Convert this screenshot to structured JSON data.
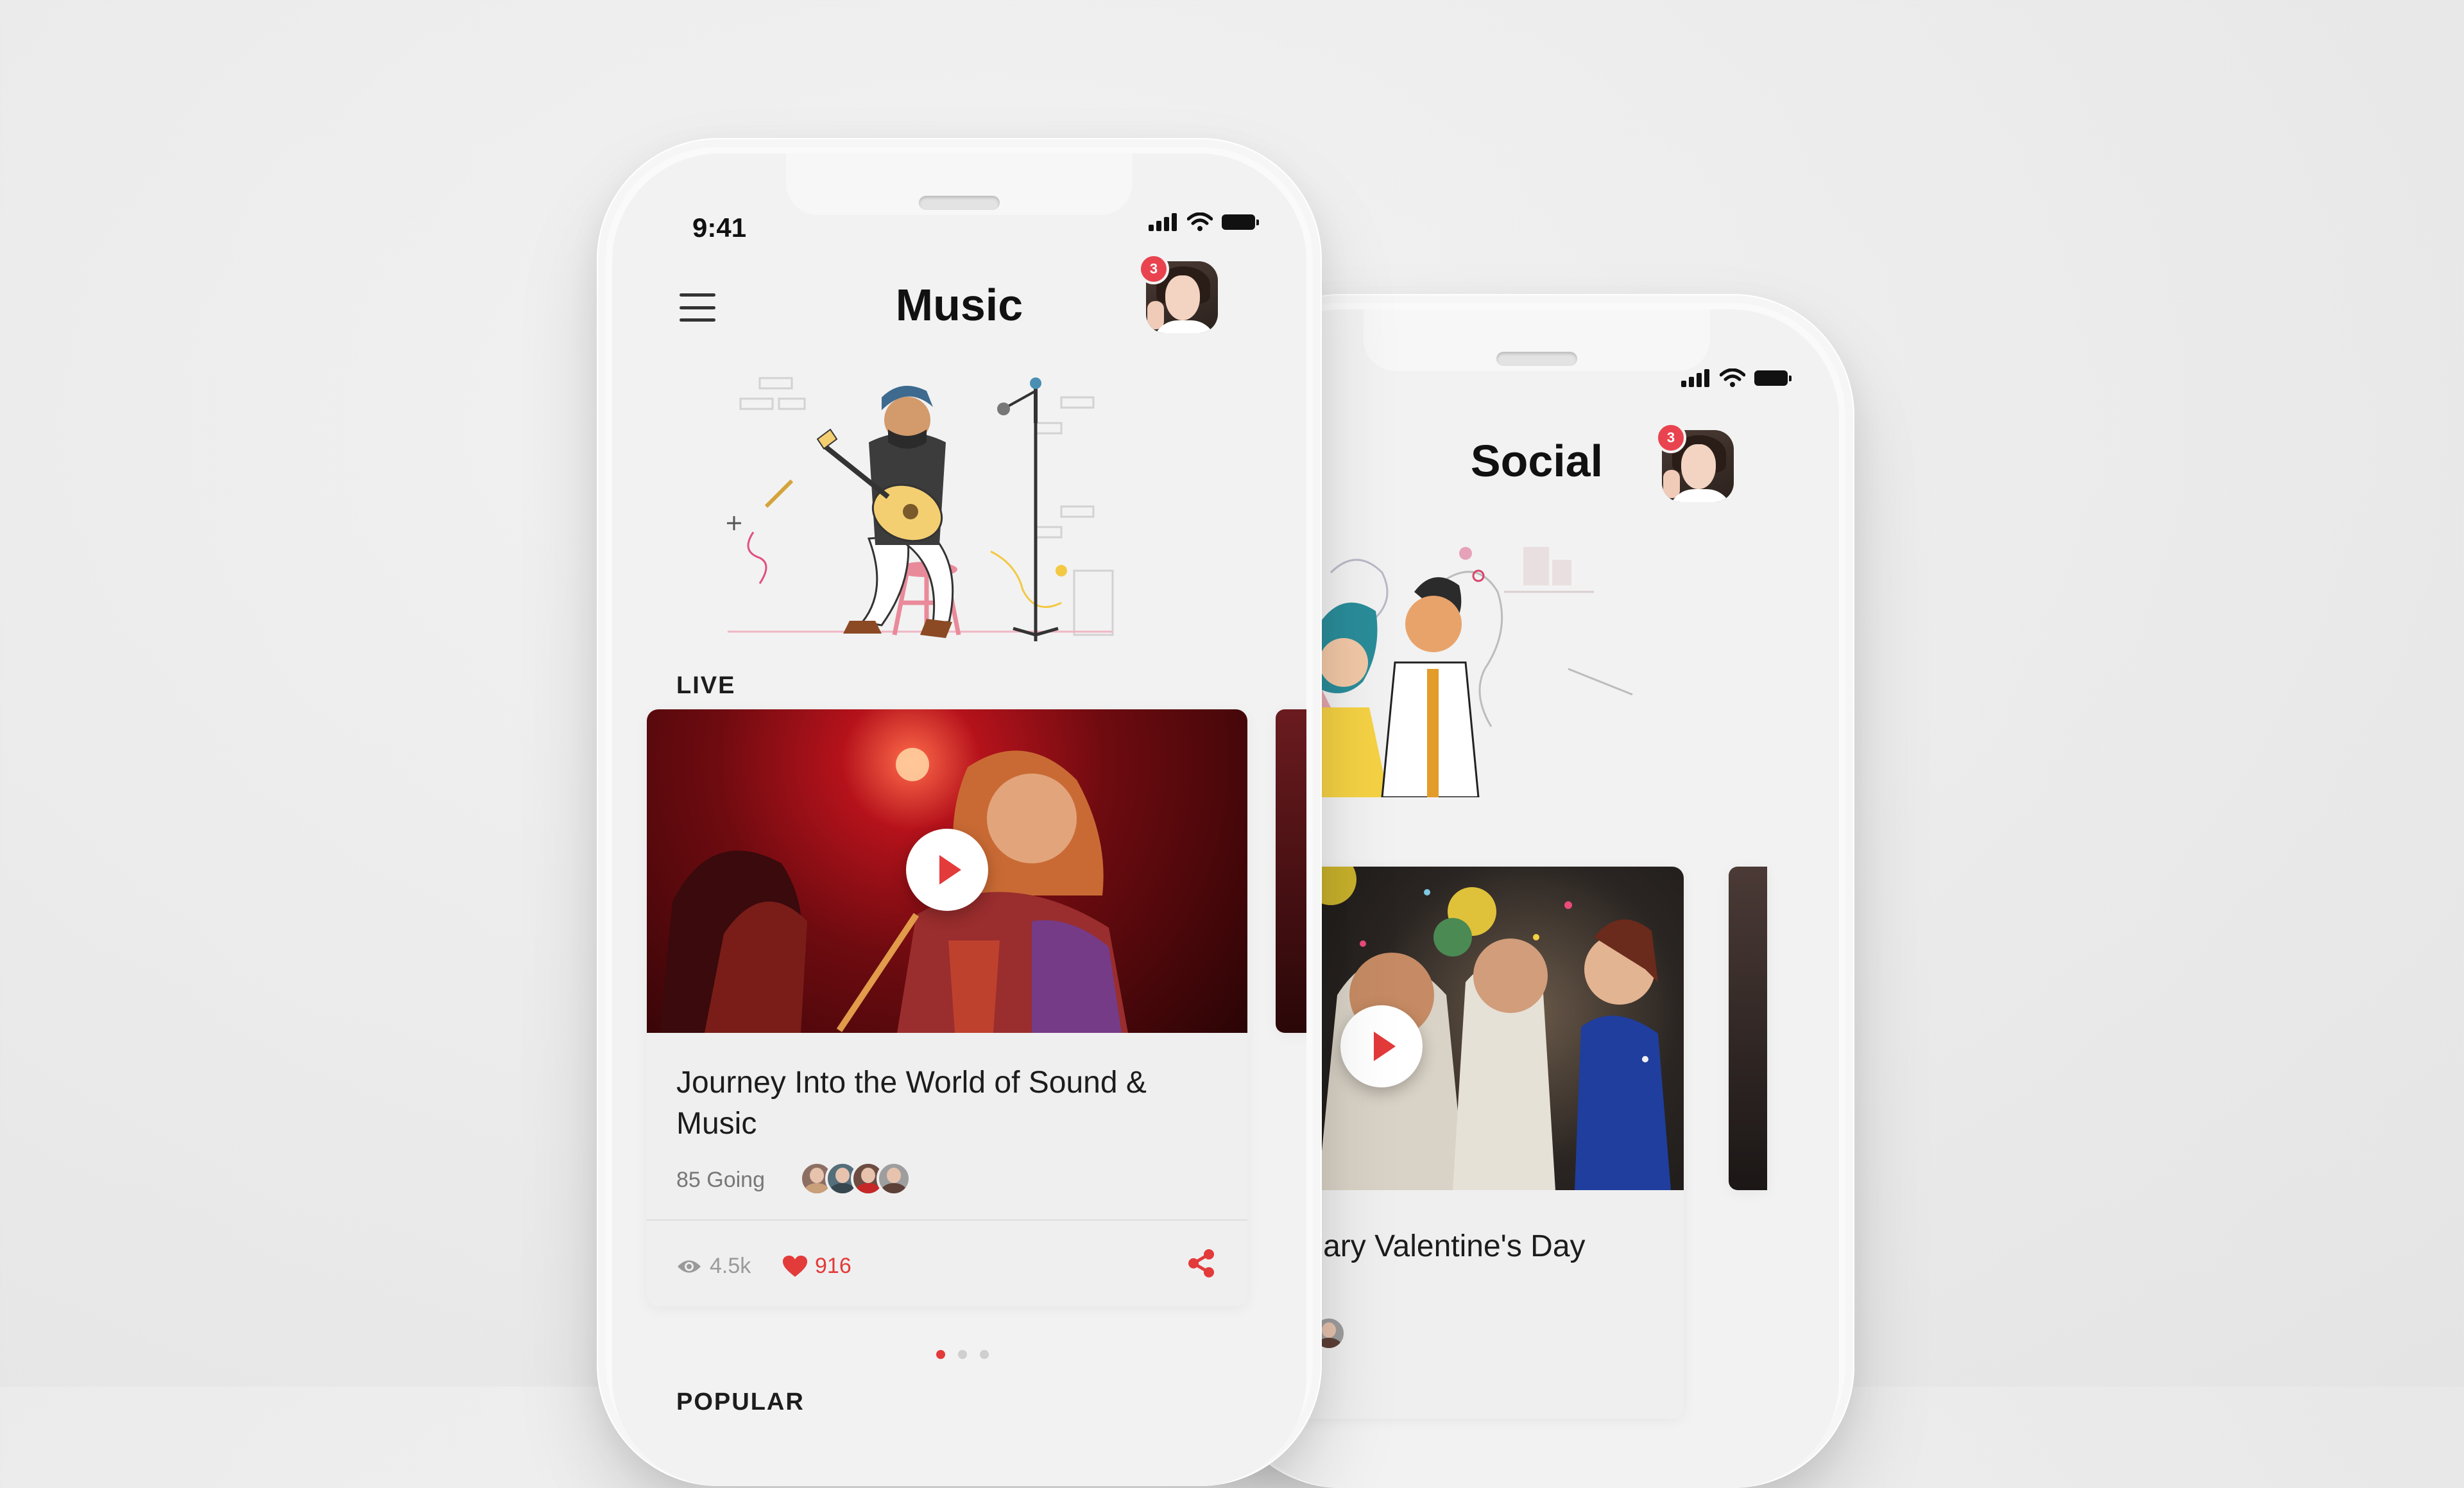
{
  "music_screen": {
    "status_time": "9:41",
    "title": "Music",
    "notification_count": "3",
    "section_live": "LIVE",
    "live_card": {
      "title": "Journey Into the World of Sound & Music",
      "going": "85 Going",
      "views": "4.5k",
      "likes": "916"
    },
    "carousel": {
      "pages": 3,
      "active": 1
    },
    "next_section": "POPULAR"
  },
  "social_screen": {
    "title": "Social",
    "notification_count": "3",
    "card": {
      "title": "xtrodinary Valentine's Day"
    }
  },
  "colors": {
    "accent": "#e33a3a",
    "badge": "#e8434f",
    "background": "#ececec",
    "screen": "#f2f2f2",
    "text": "#1c1c1c",
    "muted": "#777777"
  },
  "icons": [
    "menu-icon",
    "signal-icon",
    "wifi-icon",
    "battery-icon",
    "play-icon",
    "eye-icon",
    "heart-icon",
    "share-icon"
  ]
}
